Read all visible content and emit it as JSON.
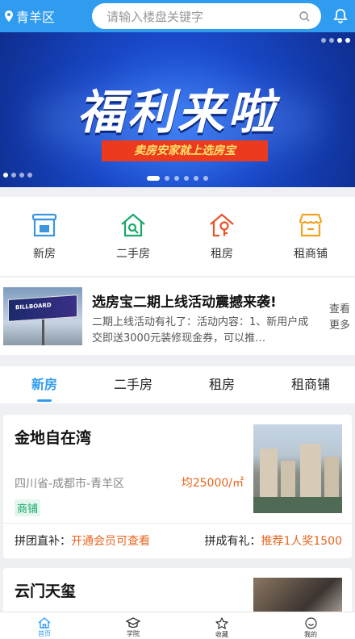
{
  "header": {
    "location": "青羊区",
    "search_placeholder": "请输入楼盘关键字"
  },
  "banner": {
    "title": "福利来啦",
    "subtitle": "卖房安家就上选房宝"
  },
  "categories": [
    {
      "label": "新房",
      "icon": "new-house-icon",
      "color": "#3b95e0"
    },
    {
      "label": "二手房",
      "icon": "second-hand-house-icon",
      "color": "#1aa86b"
    },
    {
      "label": "租房",
      "icon": "rent-house-icon",
      "color": "#e8542a"
    },
    {
      "label": "租商铺",
      "icon": "shop-icon",
      "color": "#f0a21f"
    }
  ],
  "news": {
    "title": "选房宝二期上线活动震撼来袭!",
    "desc": "二期上线活动有礼了：活动内容：1、新用户成交即送3000元装修现金券，可以推…",
    "more": "查看更多"
  },
  "tabs": [
    "新房",
    "二手房",
    "租房",
    "租商铺"
  ],
  "listings": [
    {
      "name": "金地自在湾",
      "address": "四川省-成都市-青羊区",
      "price": "均25000/㎡",
      "tag": "商铺",
      "group_label": "拼团直补：",
      "group_value": "开通会员可查看",
      "reward_label": "拼成有礼：",
      "reward_value": "推荐1人奖1500"
    },
    {
      "name": "云门天玺"
    }
  ],
  "bottom_nav": [
    "首页",
    "学院",
    "收藏",
    "我的"
  ]
}
